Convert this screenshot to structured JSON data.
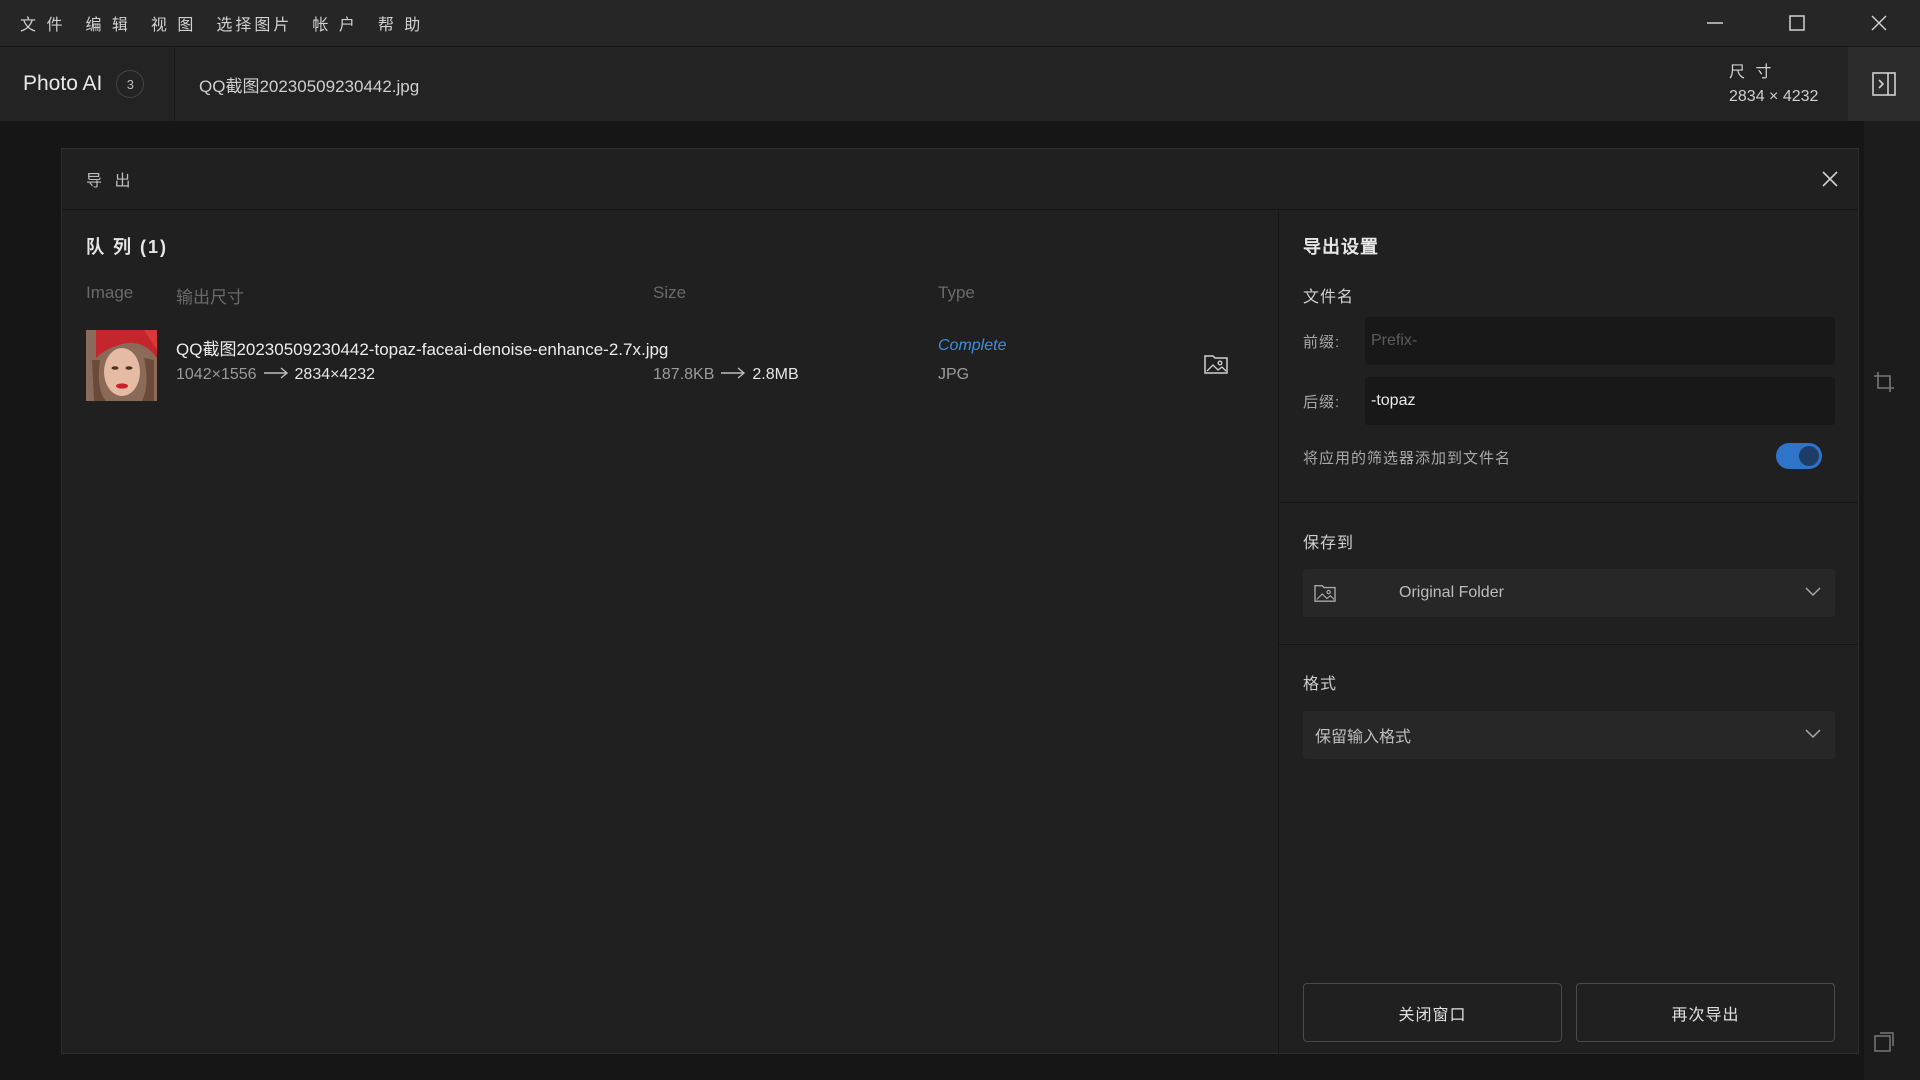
{
  "menu": [
    "文 件",
    "编 辑",
    "视 图",
    "选择图片",
    "帐 户",
    "帮 助"
  ],
  "header": {
    "app_title": "Photo AI",
    "count": "3",
    "file_title": "QQ截图20230509230442.jpg",
    "dims_label": "尺 寸",
    "dims_value": "2834 × 4232"
  },
  "modal": {
    "title": "导 出",
    "queue": {
      "title": "队 列 (1)",
      "columns": {
        "image": "Image",
        "output_size": "输出尺寸",
        "size": "Size",
        "type": "Type"
      },
      "rows": [
        {
          "filename": "QQ截图20230509230442-topaz-faceai-denoise-enhance-2.7x.jpg",
          "dims_from": "1042×1556",
          "dims_to": "2834×4232",
          "size_from": "187.8KB",
          "size_to": "2.8MB",
          "status": "Complete",
          "type": "JPG"
        }
      ]
    },
    "settings": {
      "title": "导出设置",
      "filename_label": "文件名",
      "prefix_label": "前缀:",
      "prefix_placeholder": "Prefix-",
      "prefix_value": "",
      "suffix_label": "后缀:",
      "suffix_value": "-topaz",
      "append_filters_label": "将应用的筛选器添加到文件名",
      "append_filters_on": true,
      "save_to_label": "保存到",
      "save_to_value": "Original Folder",
      "format_label": "格式",
      "format_value": "保留输入格式",
      "close_button": "关闭窗口",
      "export_again_button": "再次导出"
    }
  },
  "colors": {
    "accent": "#2f74c8",
    "status_complete": "#3d8ee0",
    "background": "#161616"
  }
}
